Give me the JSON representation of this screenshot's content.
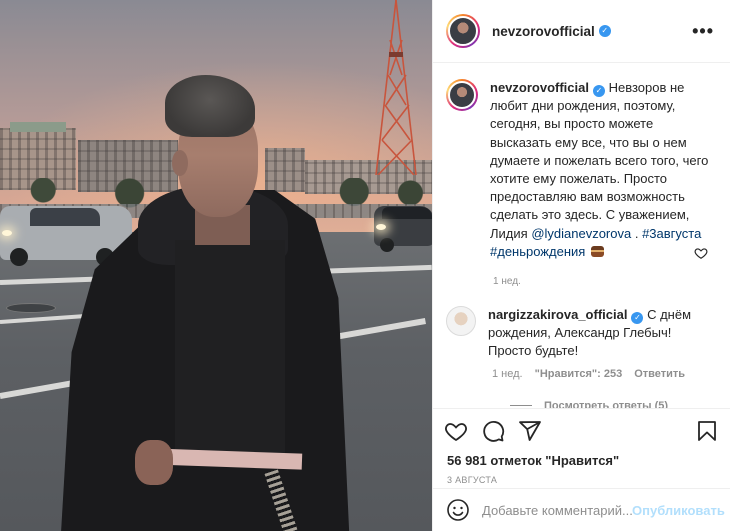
{
  "post": {
    "author": "nevzorovofficial",
    "caption_part1": "Невзоров не любит дни рождения, поэтому, сегодня, вы просто можете высказать ему все, что вы о нем думаете и пожелать всего того, чего хотите ему пожелать. Просто предоставляю вам возможность сделать это здесь. С уважением, Лидия",
    "mention": "@lydianevzorova",
    "sep": " . ",
    "hashtag1": "#3августа",
    "hashtag2": "#деньрождения",
    "caption_time": "1 нед."
  },
  "comment": {
    "author": "nargizzakirova_official",
    "text": "С днём рождения, Александр Глебыч! Просто будьте!",
    "time": "1 нед.",
    "likes": "\"Нравится\": 253",
    "reply": "Ответить",
    "view_replies": "Посмотреть ответы (5)"
  },
  "likes_text": "56 981 отметок \"Нравится\"",
  "date_text": "3 АВГУСТА",
  "add_comment_placeholder": "Добавьте комментарий...",
  "publish_label": "Опубликовать",
  "more_label": "•••",
  "colors": {
    "link": "#00376b",
    "verified": "#3897f0",
    "publish_disabled": "#b2dffc",
    "muted": "#8e8e8e"
  },
  "icons": [
    "more-options-icon",
    "verified-icon",
    "heart-icon",
    "comment-icon",
    "share-icon",
    "bookmark-icon",
    "emoji-icon",
    "small-heart-icon",
    "cake-emoji"
  ]
}
